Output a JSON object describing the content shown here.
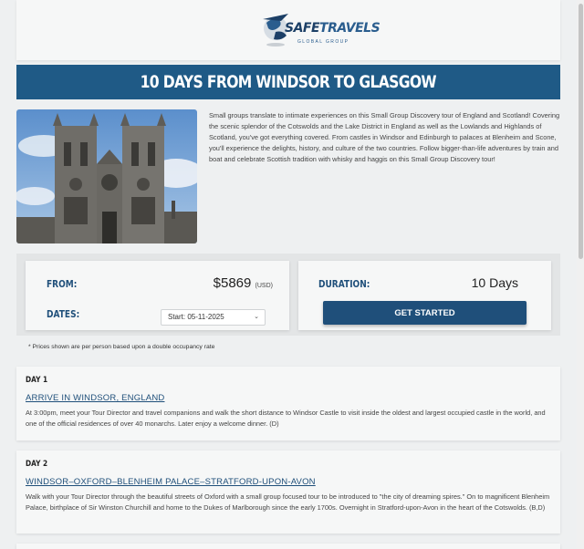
{
  "brand": {
    "name_part1": "SAFE",
    "name_part2": "TRAVELS",
    "subtitle": "GLOBAL GROUP"
  },
  "tour": {
    "title": "10 DAYS FROM WINDSOR TO GLASGOW",
    "intro": "Small groups translate to intimate experiences on this Small Group Discovery tour of England and Scotland! Covering the scenic splendor of the Cotswolds and the Lake District in England as well as the Lowlands and Highlands of Scotland, you've got everything covered. From castles in Windsor and Edinburgh to palaces at Blenheim and Scone, you'll experience the delights, history, and culture of the two countries. Follow bigger-than-life adventures by train and boat and celebrate Scottish tradition with whisky and haggis on this Small Group Discovery tour!"
  },
  "pricing": {
    "from_label": "FROM:",
    "price": "$5869",
    "currency": "(USD)",
    "dates_label": "DATES:",
    "date_value": "Start: 05-11-2025",
    "duration_label": "DURATION:",
    "duration_value": "10 Days",
    "cta_label": "GET STARTED",
    "note": "* Prices shown are per person based upon a double occupancy rate"
  },
  "itinerary": [
    {
      "day": "DAY 1",
      "title": "ARRIVE IN WINDSOR, ENGLAND",
      "description": "At 3:00pm, meet your Tour Director and travel companions and walk the short distance to Windsor Castle to visit inside the oldest and largest occupied castle in the world, and one of the official residences of over 40 monarchs. Later enjoy a welcome dinner. (D)"
    },
    {
      "day": "DAY 2",
      "title": "WINDSOR–OXFORD–BLENHEIM PALACE–STRATFORD-UPON-AVON",
      "description": "Walk with your Tour Director through the beautiful streets of Oxford with a small group focused tour to be introduced to \"the city of dreaming spires.\" On to magnificent Blenheim Palace, birthplace of Sir Winston Churchill and home to the Dukes of Marlborough since the early 1700s. Overnight in Stratford-upon-Avon in the heart of the Cotswolds. (B,D)"
    }
  ],
  "colors": {
    "brand_blue": "#1f5a86",
    "button_blue": "#1f4f7a",
    "page_bg": "#eef0f1"
  }
}
